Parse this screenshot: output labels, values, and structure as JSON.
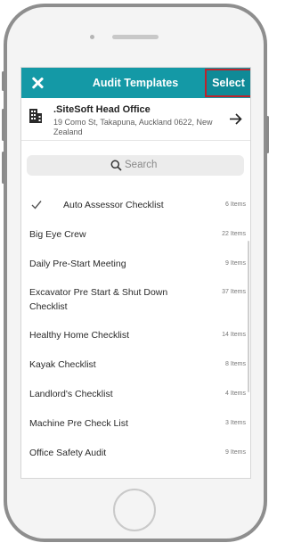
{
  "header": {
    "title": "Audit Templates",
    "select_label": "Select"
  },
  "site": {
    "name": ".SiteSoft Head Office",
    "address": "19 Como St, Takapuna, Auckland 0622, New Zealand"
  },
  "search": {
    "placeholder": "Search"
  },
  "templates": [
    {
      "name": "Auto Assessor Checklist",
      "count": "6 Items",
      "selected": true
    },
    {
      "name": "Big Eye Crew",
      "count": "22 Items",
      "selected": false
    },
    {
      "name": "Daily Pre-Start Meeting",
      "count": "9 Items",
      "selected": false
    },
    {
      "name": "Excavator Pre Start & Shut Down Checklist",
      "count": "37 Items",
      "selected": false
    },
    {
      "name": "Healthy Home Checklist",
      "count": "14 Items",
      "selected": false
    },
    {
      "name": "Kayak Checklist",
      "count": "8 Items",
      "selected": false
    },
    {
      "name": "Landlord's Checklist",
      "count": "4 Items",
      "selected": false
    },
    {
      "name": "Machine Pre Check List",
      "count": "3 Items",
      "selected": false
    },
    {
      "name": "Office Safety Audit",
      "count": "9 Items",
      "selected": false
    }
  ],
  "colors": {
    "header_bg": "#1499a6",
    "select_border": "#c0222b"
  }
}
